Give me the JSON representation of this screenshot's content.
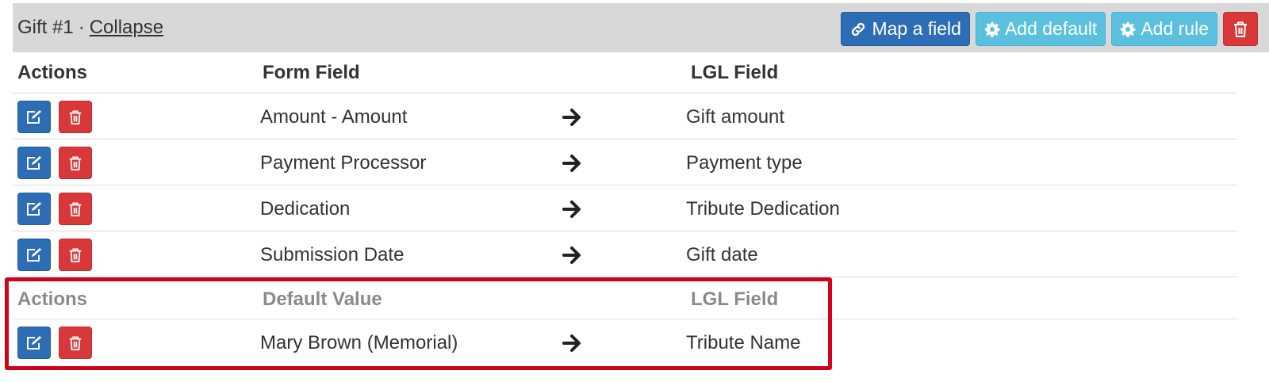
{
  "panel": {
    "title": "Gift #1",
    "separator": "·",
    "collapse_label": "Collapse",
    "buttons": {
      "map_field": "Map a field",
      "add_default": "Add default",
      "add_rule": "Add rule"
    }
  },
  "mapping_table": {
    "headers": {
      "actions": "Actions",
      "form_field": "Form Field",
      "lgl_field": "LGL Field"
    },
    "rows": [
      {
        "form_field": "Amount - Amount",
        "lgl_field": "Gift amount"
      },
      {
        "form_field": "Payment Processor",
        "lgl_field": "Payment type"
      },
      {
        "form_field": "Dedication",
        "lgl_field": "Tribute Dedication"
      },
      {
        "form_field": "Submission Date",
        "lgl_field": "Gift date"
      }
    ]
  },
  "default_table": {
    "headers": {
      "actions": "Actions",
      "default_value": "Default Value",
      "lgl_field": "LGL Field"
    },
    "rows": [
      {
        "default_value": "Mary Brown (Memorial)",
        "lgl_field": "Tribute Name"
      }
    ]
  },
  "colors": {
    "primary": "#2c6db5",
    "info": "#5bc0de",
    "danger": "#d9383a",
    "highlight": "#d0021b",
    "header_bg": "#d8d8d8"
  },
  "icons": {
    "map_field": "link-icon",
    "add_default": "gear-icon",
    "add_rule": "gear-icon",
    "delete": "trash-icon",
    "edit": "edit-icon",
    "mapping": "arrow-right-icon"
  }
}
